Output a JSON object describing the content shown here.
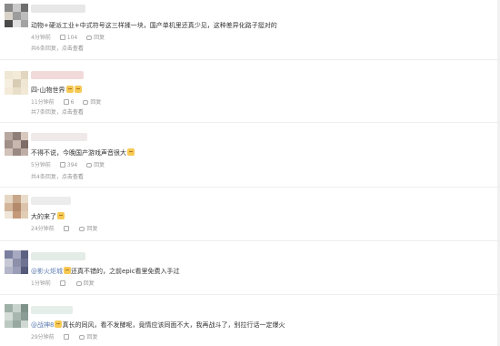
{
  "comments": [
    {
      "text": "动物+硬派工业+中式符号这三样揉一块，国产单机里还真少见，这种差异化路子挺对的",
      "time": "4分钟前",
      "likes": "104",
      "reply_label": "回复",
      "replies_text": "共6条回复，",
      "view_text": "点击查看",
      "avatar_colors": [
        "#8a8a8a",
        "#c9c9c9",
        "#6e6e6e",
        "#d8d2c8",
        "#9c9c9c",
        "#bdbdbd",
        "#4a4a4a",
        "#e0e0e0",
        "#a3a3a3"
      ],
      "name_color": "#e7e7e7"
    },
    {
      "text": "四-山物世界",
      "time": "11分钟前",
      "likes": "6",
      "reply_label": "回复",
      "replies_text": "共7条回复，",
      "view_text": "点击查看",
      "avatar_colors": [
        "#efe6d4",
        "#f3ead8",
        "#e2d6bf",
        "#f6efe1",
        "#d8ccb4",
        "#efe6d4",
        "#f3ead8",
        "#e9dfc9",
        "#f1e8d6"
      ],
      "name_color": "#f2dada"
    },
    {
      "text": "不得不说，今晚国产游戏声音很大",
      "time": "5分钟前",
      "likes": "394",
      "reply_label": "回复",
      "replies_text": "共4条回复，",
      "view_text": "点击查看",
      "avatar_colors": [
        "#b9a8a0",
        "#8f7d78",
        "#d8c8be",
        "#a08e88",
        "#c7b7ae",
        "#7d6c67",
        "#d1c2ba",
        "#9a8882",
        "#bfaea6"
      ],
      "name_color": "#f0e9e9"
    },
    {
      "text": "大的来了",
      "time": "24分钟前",
      "likes": "",
      "reply_label": "回复",
      "replies_text": "",
      "view_text": "",
      "avatar_colors": [
        "#e6d7c4",
        "#c8a68a",
        "#e9dccb",
        "#d3b59a",
        "#b38b6c",
        "#dcc4ac",
        "#efe5d8",
        "#c49a7a",
        "#e1cdb6"
      ],
      "name_color": "#ececec"
    },
    {
      "mention": "@影火炬城",
      "text": "还真不错的，之前epic看里免费入手过",
      "time": "1分钟前",
      "likes": "",
      "reply_label": "回复",
      "replies_text": "",
      "view_text": "",
      "avatar_colors": [
        "#7b7fa0",
        "#a7a9c0",
        "#5e6282",
        "#c7c8d6",
        "#8d90ab",
        "#6f7392",
        "#b4b6c9",
        "#9b9eb6",
        "#55597a"
      ],
      "name_color": "#e3ece6"
    },
    {
      "mention": "@战神8",
      "text": "真长的同风，看不发酵呢，竟情应该同面不大，我再战斗了，别拉行话一定爆火",
      "time": "29分钟前",
      "likes": "",
      "reply_label": "回复",
      "replies_text": "",
      "view_text": "",
      "avatar_colors": [
        "#9fb0a8",
        "#c9d3ce",
        "#7f928a",
        "#d5ddd9",
        "#a8b8b1",
        "#8a9c95",
        "#bcc8c2",
        "#96a89f",
        "#cfd8d3"
      ],
      "name_color": "#e6eee9"
    }
  ],
  "icons": {
    "like": "like-icon",
    "reply": "reply-icon",
    "emoji": "emoji-icon",
    "more": "more-icon"
  }
}
